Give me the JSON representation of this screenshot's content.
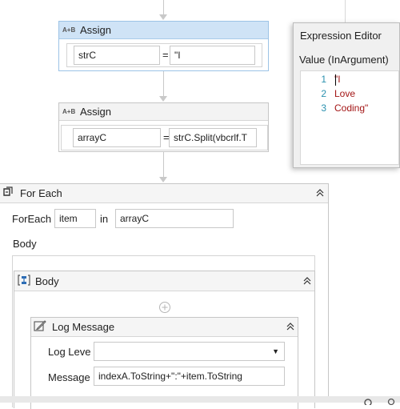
{
  "assign1": {
    "title": "Assign",
    "icon_label": "A+B",
    "to": "strC",
    "eq": "=",
    "value": "\"I"
  },
  "assign2": {
    "title": "Assign",
    "icon_label": "A+B",
    "to": "arrayC",
    "eq": "=",
    "value": "strC.Split(vbcrlf.T"
  },
  "foreach": {
    "title": "For Each",
    "foreach_label": "ForEach",
    "item": "item",
    "in_label": "in",
    "collection": "arrayC",
    "body_label": "Body",
    "body_seq": {
      "title": "Body"
    },
    "log": {
      "title": "Log Message",
      "level_label": "Log Leve",
      "level_value": "",
      "message_label": "Message",
      "message_value": "indexA.ToString+\":\"+item.ToString"
    }
  },
  "expression_editor": {
    "title": "Expression Editor",
    "subtitle": "Value (InArgument)",
    "lines": [
      {
        "num": "1",
        "text": "\"I"
      },
      {
        "num": "2",
        "text": "Love"
      },
      {
        "num": "3",
        "text": "Coding\""
      }
    ]
  },
  "colors": {
    "selected_header": "#cfe3f6",
    "string_literal": "#a31515",
    "line_number": "#2b91af"
  }
}
